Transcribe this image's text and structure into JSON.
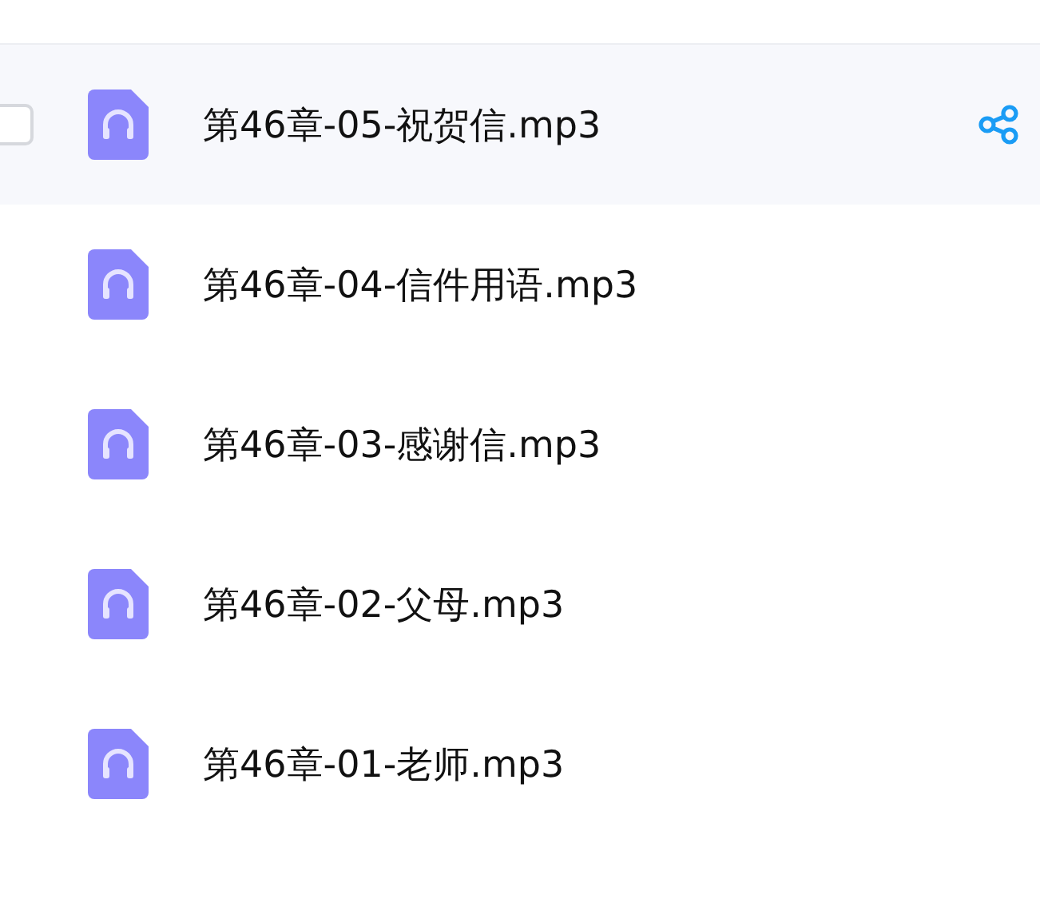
{
  "files": [
    {
      "name": "第46章-05-祝贺信.mp3",
      "hovered": true
    },
    {
      "name": "第46章-04-信件用语.mp3",
      "hovered": false
    },
    {
      "name": "第46章-03-感谢信.mp3",
      "hovered": false
    },
    {
      "name": "第46章-02-父母.mp3",
      "hovered": false
    },
    {
      "name": "第46章-01-老师.mp3",
      "hovered": false
    }
  ]
}
